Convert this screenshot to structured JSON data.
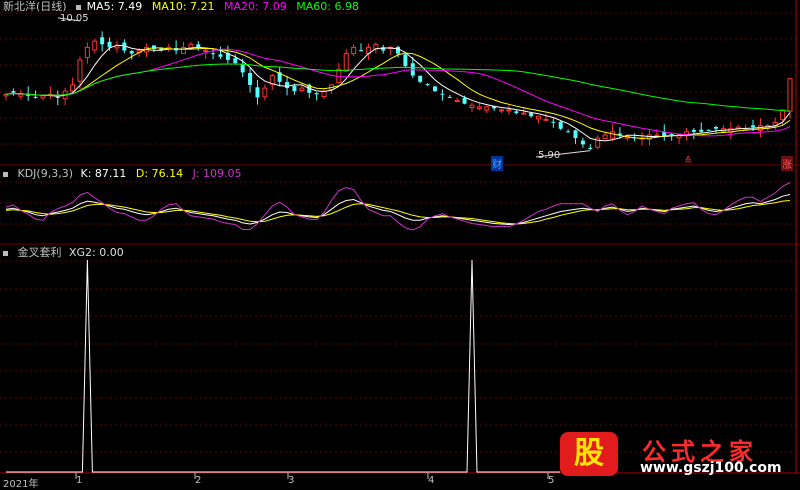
{
  "main": {
    "title": "新北洋(日线)",
    "ma": [
      {
        "label": "MA5: 7.49",
        "color": "#ffffff"
      },
      {
        "label": "MA10: 7.21",
        "color": "#ffff00"
      },
      {
        "label": "MA20: 7.09",
        "color": "#ff00ff"
      },
      {
        "label": "MA60: 6.98",
        "color": "#00ff00"
      }
    ],
    "high_label": "10.05",
    "low_label": "5.90",
    "event_tags": [
      {
        "text": "财",
        "color": "#4aa3ff"
      },
      {
        "text": "≙",
        "color": "#ff3333"
      },
      {
        "text": "涨",
        "color": "#ff3333"
      }
    ]
  },
  "kdj": {
    "title": "KDJ(9,3,3)",
    "k": "K: 87.11",
    "d": "D: 76.14",
    "j": "J: 109.05",
    "colors": {
      "k": "#ffffff",
      "d": "#ffff00",
      "j": "#cc33cc"
    }
  },
  "indicator": {
    "title": "金叉套利",
    "value": "XG2: 0.00",
    "spikes_at_candle": [
      11,
      63
    ]
  },
  "axis": {
    "labels": [
      "2021年",
      "1",
      "2",
      "3",
      "4",
      "5"
    ]
  },
  "watermark": {
    "badge": "股",
    "title": "公式之家",
    "url": "www.gszj100.com"
  },
  "colors": {
    "up": "#ff3232",
    "down": "#54ffff",
    "grid": "#6e0000"
  },
  "chart_data": [
    {
      "type": "candlestick",
      "title": "新北洋(日线)",
      "price_range": [
        5.6,
        10.3
      ],
      "annotations": [
        {
          "label": "10.05",
          "value": 10.05
        },
        {
          "label": "5.90",
          "value": 5.9
        }
      ],
      "closes": [
        7.7,
        7.75,
        7.7,
        7.65,
        7.6,
        7.65,
        7.7,
        7.6,
        7.8,
        8.0,
        8.8,
        9.2,
        9.4,
        9.3,
        9.2,
        9.25,
        9.1,
        9.0,
        9.1,
        9.2,
        9.15,
        9.1,
        9.2,
        9.1,
        9.2,
        9.3,
        9.2,
        9.1,
        9.0,
        8.9,
        8.8,
        8.7,
        8.4,
        8.0,
        7.6,
        7.9,
        8.3,
        8.1,
        7.9,
        7.8,
        7.9,
        7.75,
        7.7,
        7.8,
        8.0,
        8.5,
        9.0,
        9.2,
        9.1,
        9.2,
        9.3,
        9.1,
        9.2,
        9.0,
        8.6,
        8.3,
        8.1,
        8.0,
        7.8,
        7.7,
        7.6,
        7.5,
        7.4,
        7.35,
        7.3,
        7.3,
        7.25,
        7.2,
        7.2,
        7.1,
        7.1,
        7.0,
        7.0,
        6.9,
        6.8,
        6.6,
        6.5,
        6.3,
        6.1,
        5.95,
        6.3,
        6.4,
        6.5,
        6.4,
        6.35,
        6.3,
        6.3,
        6.4,
        6.4,
        6.35,
        6.4,
        6.4,
        6.5,
        6.5,
        6.5,
        6.55,
        6.6,
        6.6,
        6.6,
        6.65,
        6.6,
        6.65,
        6.7,
        6.7,
        6.8,
        7.2,
        8.2
      ],
      "series": [
        {
          "name": "MA5",
          "color": "#ffffff"
        },
        {
          "name": "MA10",
          "color": "#ffff00"
        },
        {
          "name": "MA20",
          "color": "#ff00ff"
        },
        {
          "name": "MA60",
          "color": "#00ff00"
        }
      ]
    },
    {
      "type": "line",
      "title": "KDJ(9,3,3)",
      "y_range": [
        0,
        110
      ],
      "series": [
        {
          "name": "K",
          "color": "#ffffff",
          "values": [
            60,
            62,
            58,
            55,
            50,
            48,
            52,
            55,
            58,
            62,
            70,
            75,
            73,
            70,
            66,
            62,
            60,
            56,
            52,
            50,
            52,
            56,
            60,
            62,
            58,
            54,
            52,
            50,
            48,
            45,
            42,
            40,
            35,
            33,
            36,
            42,
            50,
            55,
            54,
            50,
            48,
            46,
            45,
            50,
            60,
            70,
            76,
            78,
            72,
            66,
            62,
            58,
            56,
            50,
            44,
            40,
            40,
            44,
            46,
            48,
            46,
            44,
            42,
            40,
            38,
            36,
            34,
            33,
            32,
            33,
            36,
            40,
            44,
            48,
            52,
            56,
            58,
            60,
            62,
            60,
            58,
            62,
            64,
            60,
            56,
            58,
            62,
            60,
            58,
            56,
            60,
            62,
            64,
            66,
            62,
            58,
            56,
            58,
            62,
            66,
            70,
            72,
            70,
            74,
            78,
            84,
            87.11
          ]
        },
        {
          "name": "D",
          "color": "#ffff00",
          "values": [
            58,
            59,
            58,
            57,
            54,
            52,
            51,
            52,
            54,
            57,
            62,
            67,
            69,
            69,
            68,
            66,
            64,
            61,
            58,
            55,
            54,
            54,
            56,
            58,
            58,
            57,
            55,
            53,
            51,
            49,
            46,
            44,
            41,
            38,
            37,
            38,
            42,
            46,
            49,
            50,
            49,
            48,
            47,
            48,
            52,
            58,
            64,
            69,
            70,
            69,
            66,
            63,
            60,
            57,
            53,
            49,
            46,
            45,
            45,
            46,
            46,
            45,
            44,
            43,
            41,
            39,
            37,
            35,
            34,
            33,
            34,
            36,
            38,
            42,
            45,
            49,
            52,
            55,
            58,
            59,
            59,
            60,
            61,
            61,
            59,
            59,
            60,
            60,
            59,
            58,
            59,
            60,
            61,
            63,
            63,
            61,
            59,
            58,
            59,
            61,
            64,
            67,
            68,
            70,
            72,
            75,
            76.14
          ]
        },
        {
          "name": "J",
          "color": "#cc33cc",
          "values": [
            64,
            68,
            58,
            51,
            42,
            40,
            54,
            61,
            66,
            72,
            86,
            91,
            81,
            72,
            62,
            54,
            52,
            46,
            40,
            40,
            48,
            60,
            68,
            70,
            58,
            48,
            46,
            44,
            42,
            37,
            34,
            32,
            23,
            23,
            34,
            50,
            66,
            73,
            64,
            50,
            46,
            42,
            41,
            54,
            76,
            94,
            100,
            96,
            76,
            60,
            54,
            48,
            48,
            36,
            26,
            22,
            28,
            42,
            48,
            52,
            46,
            42,
            38,
            34,
            32,
            30,
            28,
            29,
            28,
            33,
            40,
            48,
            56,
            60,
            66,
            70,
            70,
            70,
            70,
            62,
            56,
            66,
            70,
            58,
            50,
            56,
            66,
            60,
            56,
            52,
            62,
            66,
            70,
            72,
            60,
            52,
            50,
            58,
            68,
            76,
            82,
            82,
            74,
            82,
            90,
            102,
            109.05
          ]
        }
      ]
    },
    {
      "type": "line",
      "title": "金叉套利",
      "series": [
        {
          "name": "XG2",
          "color": "#ffffff",
          "spikes_at_candle": [
            11,
            63
          ],
          "current": 0.0
        }
      ]
    }
  ]
}
